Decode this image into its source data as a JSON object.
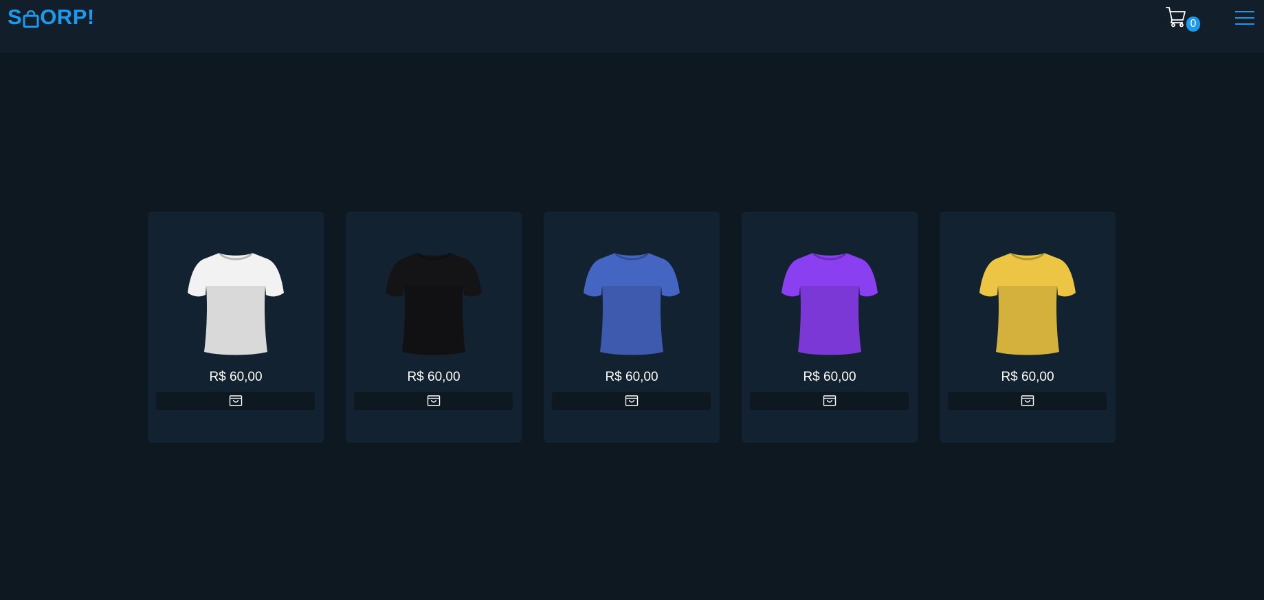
{
  "header": {
    "logo_part1": "S",
    "logo_part2": "ORP!",
    "logo_icon": "shopping-bag-icon",
    "cart_icon": "shopping-cart-icon",
    "cart_count": "0",
    "menu_icon": "hamburger-menu-icon"
  },
  "colors": {
    "accent": "#1b9bf0",
    "background": "#0e1821",
    "header": "#121f2b",
    "card": "#132230"
  },
  "products": [
    {
      "color_name": "white",
      "shirt_color": "#f2f2f2",
      "price": "R$ 60,00",
      "button_icon": "shopping-bag-icon"
    },
    {
      "color_name": "black",
      "shirt_color": "#141416",
      "price": "R$ 60,00",
      "button_icon": "shopping-bag-icon"
    },
    {
      "color_name": "blue",
      "shirt_color": "#4465c2",
      "price": "R$ 60,00",
      "button_icon": "shopping-bag-icon"
    },
    {
      "color_name": "purple",
      "shirt_color": "#8a3ff0",
      "price": "R$ 60,00",
      "button_icon": "shopping-bag-icon"
    },
    {
      "color_name": "yellow",
      "shirt_color": "#ecc545",
      "price": "R$ 60,00",
      "button_icon": "shopping-bag-icon"
    }
  ]
}
